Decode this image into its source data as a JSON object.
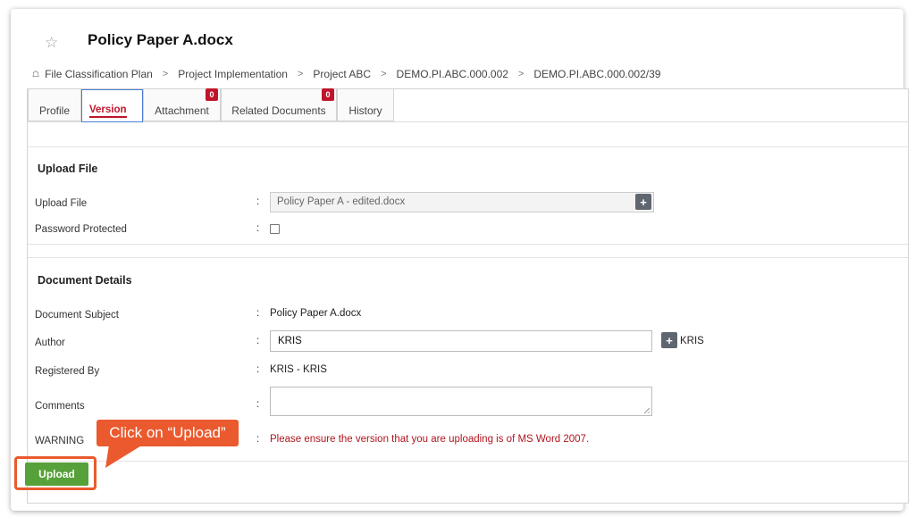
{
  "page": {
    "title": "Policy Paper A.docx"
  },
  "breadcrumb": [
    "File Classification Plan",
    "Project Implementation",
    "Project ABC",
    "DEMO.PI.ABC.000.002",
    "DEMO.PI.ABC.000.002/39"
  ],
  "tabs": [
    {
      "label": "Profile"
    },
    {
      "label": "Version",
      "active": true
    },
    {
      "label": "Attachment",
      "badge": "0"
    },
    {
      "label": "Related Documents",
      "badge": "0"
    },
    {
      "label": "History"
    }
  ],
  "upload_section": {
    "title": "Upload File",
    "upload_file_label": "Upload File",
    "upload_file_value": "Policy Paper A - edited.docx",
    "password_label": "Password Protected",
    "password_checked": false
  },
  "details_section": {
    "title": "Document Details",
    "subject_label": "Document Subject",
    "subject_value": "Policy Paper A.docx",
    "author_label": "Author",
    "author_value": "KRIS",
    "author_tag": "KRIS",
    "registered_label": "Registered By",
    "registered_value": "KRIS - KRIS",
    "comments_label": "Comments",
    "comments_value": "",
    "warning_label": "WARNING",
    "warning_text": "Please ensure the version that you are uploading is of MS Word 2007."
  },
  "colon": ":",
  "plus_symbol": "+",
  "upload_button": {
    "label": "Upload"
  },
  "annotation": {
    "text": "Click on “Upload”"
  },
  "colors": {
    "accent_red": "#c0152c",
    "upload_green": "#57a13a",
    "callout_orange": "#ea5a2e",
    "active_tab_border": "#4a7bd0"
  },
  "icons": {
    "star": "star-icon",
    "home": "home-icon",
    "plus": "plus-icon"
  }
}
